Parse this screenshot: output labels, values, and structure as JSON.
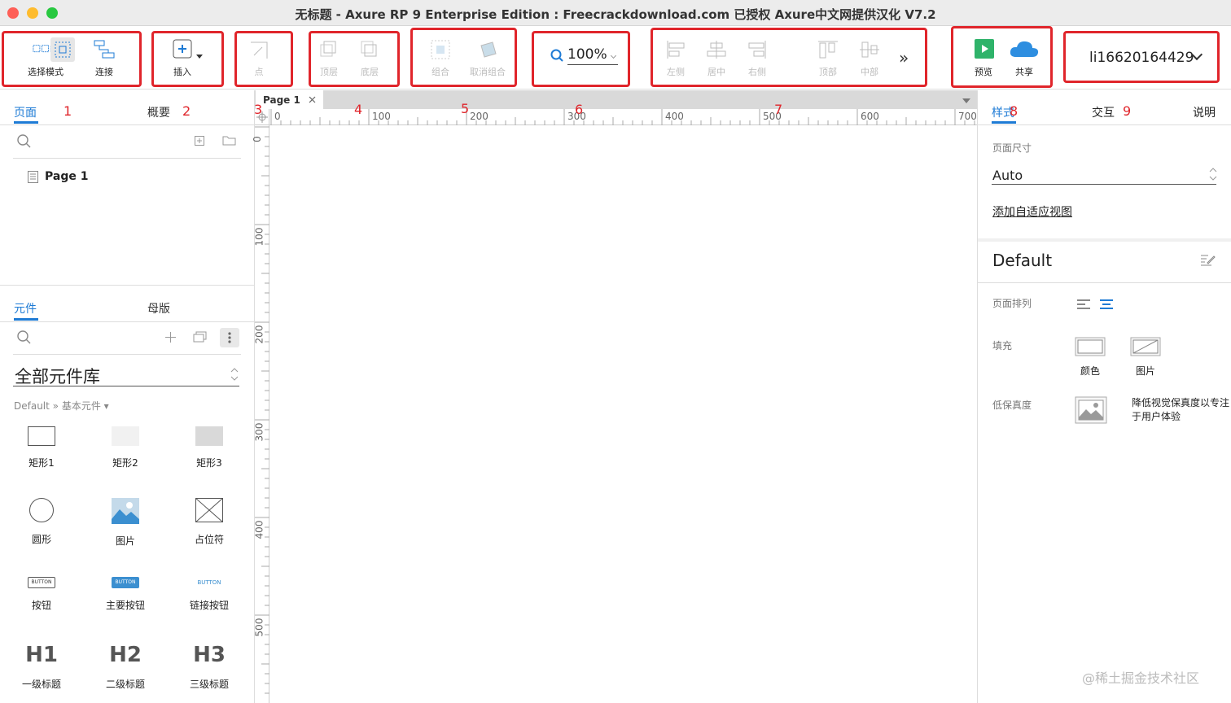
{
  "window": {
    "title": "无标题 - Axure RP 9 Enterprise Edition : Freecrackdownload.com 已授权     Axure中文网提供汉化 V7.2"
  },
  "toolbar": {
    "select_mode": "选择模式",
    "connect": "连接",
    "insert": "插入",
    "point": "点",
    "top_layer": "顶层",
    "bottom_layer": "底层",
    "group": "组合",
    "ungroup": "取消组合",
    "zoom": "100%",
    "align_left": "左侧",
    "align_center": "居中",
    "align_right": "右侧",
    "align_top": "顶部",
    "align_middle": "中部",
    "more": "»",
    "preview": "预览",
    "share": "共享",
    "user": "li16620164429"
  },
  "markers": [
    "1",
    "2",
    "3",
    "4",
    "5",
    "6",
    "7",
    "8",
    "9"
  ],
  "left": {
    "tabs": [
      "页面",
      "概要"
    ],
    "pages": [
      "Page 1"
    ],
    "lib_tabs": [
      "元件",
      "母版"
    ],
    "library": "全部元件库",
    "breadcrumb": "Default » 基本元件 ▾",
    "components": [
      "矩形1",
      "矩形2",
      "矩形3",
      "圆形",
      "图片",
      "占位符",
      "按钮",
      "主要按钮",
      "链接按钮",
      "一级标题",
      "二级标题",
      "三级标题"
    ],
    "button_text": "BUTTON",
    "headings": [
      "H1",
      "H2",
      "H3"
    ]
  },
  "canvas": {
    "tab": "Page 1",
    "ruler_h": [
      "0",
      "100",
      "200",
      "300",
      "400",
      "500",
      "600",
      "700"
    ],
    "ruler_v": [
      "0",
      "100",
      "200",
      "300",
      "400",
      "500"
    ]
  },
  "right": {
    "tabs": [
      "样式",
      "交互",
      "说明"
    ],
    "page_size_label": "页面尺寸",
    "page_size": "Auto",
    "adaptive_link": "添加自适应视图",
    "style_name": "Default",
    "page_align_label": "页面排列",
    "fill_label": "填充",
    "fill_color": "颜色",
    "fill_image": "图片",
    "low_fidelity_label": "低保真度",
    "low_fidelity_desc": "降低视觉保真度以专注于用户体验"
  },
  "watermark": "@稀土掘金技术社区",
  "colors": {
    "accent": "#1e7bd5",
    "annotation": "#e0252b",
    "preview": "#2fb36a",
    "share": "#2e8ee0"
  }
}
